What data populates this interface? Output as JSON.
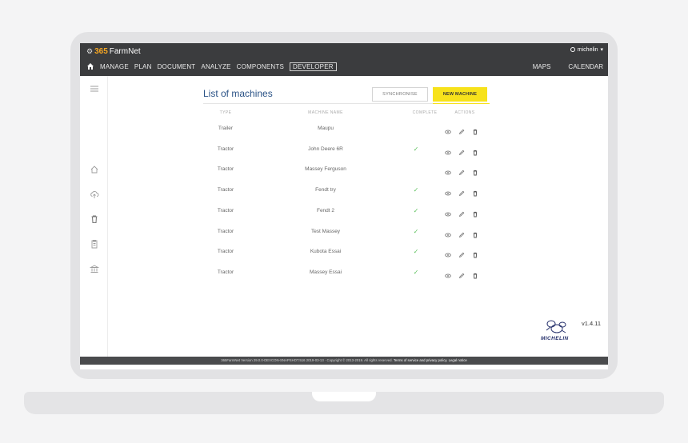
{
  "header": {
    "logo_num": "365",
    "logo_text": "FarmNet",
    "user": "michelin",
    "nav": [
      "MANAGE",
      "PLAN",
      "DOCUMENT",
      "ANALYZE",
      "COMPONENTS",
      "DEVELOPER"
    ],
    "active_nav": "DEVELOPER",
    "nav_right": [
      "MAPS",
      "CALENDAR"
    ]
  },
  "main": {
    "title": "List of machines",
    "sync_label": "SYNCHRONISE",
    "new_label": "NEW MACHINE",
    "columns": {
      "type": "TYPE",
      "name": "MACHINE NAME",
      "complete": "COMPLETE",
      "actions": "ACTIONS"
    },
    "rows": [
      {
        "type": "Trailer",
        "name": "Maupu",
        "complete": false
      },
      {
        "type": "Tractor",
        "name": "John Deere 6R",
        "complete": true
      },
      {
        "type": "Tractor",
        "name": "Massey Ferguson",
        "complete": false
      },
      {
        "type": "Tractor",
        "name": "Fendt try",
        "complete": true
      },
      {
        "type": "Tractor",
        "name": "Fendt 2",
        "complete": true
      },
      {
        "type": "Tractor",
        "name": "Test Massey",
        "complete": true
      },
      {
        "type": "Tractor",
        "name": "Kubota Essai",
        "complete": true
      },
      {
        "type": "Tractor",
        "name": "Massey Essai",
        "complete": true
      }
    ],
    "check_glyph": "✓"
  },
  "version": "v1.4.11",
  "brand": "MICHELIN",
  "footer": {
    "text": "365FarmNet Version 29.0.0-DEVCON-SNAPSHOT.516 2019-03-13 · Copyright © 2013-2019. All rights reserved.",
    "terms": "Terms of service and privacy policy.",
    "legal": "Legal notice"
  },
  "colors": {
    "accent": "#f7e21b",
    "title": "#2a5286",
    "header": "#3b3c3e",
    "check": "#5cc05c"
  }
}
